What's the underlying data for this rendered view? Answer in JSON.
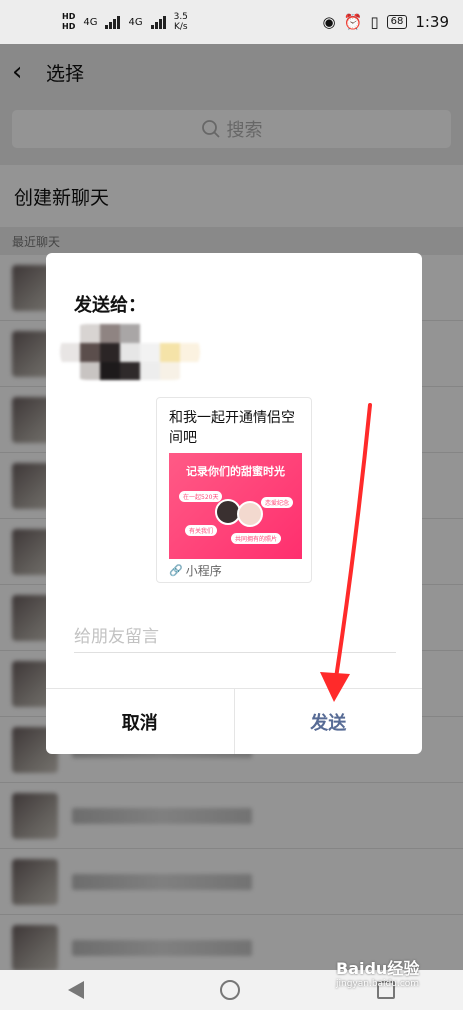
{
  "status_bar": {
    "network_1": "4G",
    "network_2": "4G",
    "speed_value": "3.5",
    "speed_unit": "K/s",
    "battery": "68",
    "time": "1:39"
  },
  "header": {
    "title": "选择"
  },
  "search": {
    "placeholder": "搜索"
  },
  "new_chat_label": "创建新聊天",
  "recent_label": "最近聊天",
  "dialog": {
    "title": "发送给：",
    "card": {
      "text": "和我一起开通情侣空间吧",
      "image_heading": "记录你们的甜蜜时光",
      "pill_1": "在一起520天",
      "pill_2": "恋爱纪念",
      "pill_3": "有关我们",
      "pill_4": "共同拥有的照片",
      "footer": "小程序"
    },
    "message_placeholder": "给朋友留言",
    "cancel_label": "取消",
    "send_label": "发送"
  },
  "watermark": {
    "brand": "Baidu经验",
    "url": "jingyan.baidu.com"
  },
  "colors": {
    "send": "#576b95",
    "arrow": "#ff2a2a",
    "card_image": "#ff3f77"
  },
  "icons": {
    "back": "back-arrow-icon",
    "search": "search-icon",
    "eye": "eye-icon",
    "alarm": "alarm-icon",
    "vibrate": "vibrate-icon",
    "link": "link-icon"
  }
}
